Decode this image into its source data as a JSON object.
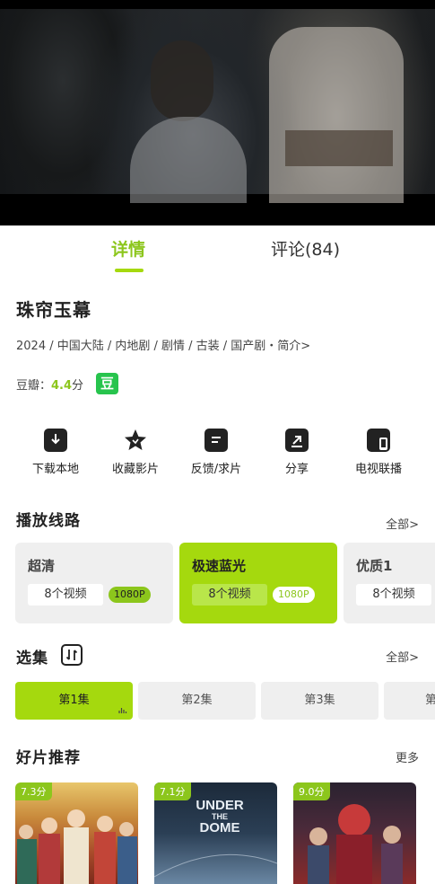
{
  "tabs": [
    {
      "label": "详情"
    },
    {
      "label": "评论(84)"
    }
  ],
  "show": {
    "title": "珠帘玉幕",
    "meta": "2024 / 中国大陆 / 内地剧 / 剧情 / 古装 / 国产剧・简介>",
    "rating_label": "豆瓣：",
    "rating_score": "4.4",
    "rating_unit": "分",
    "douban_badge": "豆"
  },
  "actions": [
    {
      "label": "下载本地",
      "icon": "download-icon"
    },
    {
      "label": "收藏影片",
      "icon": "star-icon"
    },
    {
      "label": "反馈/求片",
      "icon": "feedback-icon"
    },
    {
      "label": "分享",
      "icon": "share-icon"
    },
    {
      "label": "电视联播",
      "icon": "tv-cast-icon"
    }
  ],
  "routes": {
    "title": "播放线路",
    "more": "全部>",
    "items": [
      {
        "name": "超清",
        "count": "8个视频",
        "res": "1080P"
      },
      {
        "name": "极速蓝光",
        "count": "8个视频",
        "res": "1080P"
      },
      {
        "name": "优质1",
        "count": "8个视频"
      }
    ]
  },
  "episodes": {
    "title": "选集",
    "more": "全部>",
    "items": [
      {
        "label": "第1集"
      },
      {
        "label": "第2集"
      },
      {
        "label": "第3集"
      },
      {
        "label": "第"
      }
    ]
  },
  "recommend": {
    "title": "好片推荐",
    "more": "更多",
    "items": [
      {
        "score": "7.3分"
      },
      {
        "score": "7.1分",
        "poster_text_1": "UNDER",
        "poster_text_2": "THE",
        "poster_text_3": "DOME"
      },
      {
        "score": "9.0分"
      }
    ]
  },
  "colors": {
    "accent": "#a5d90e",
    "accent_text": "#8cc61c",
    "douban": "#27c44d"
  }
}
